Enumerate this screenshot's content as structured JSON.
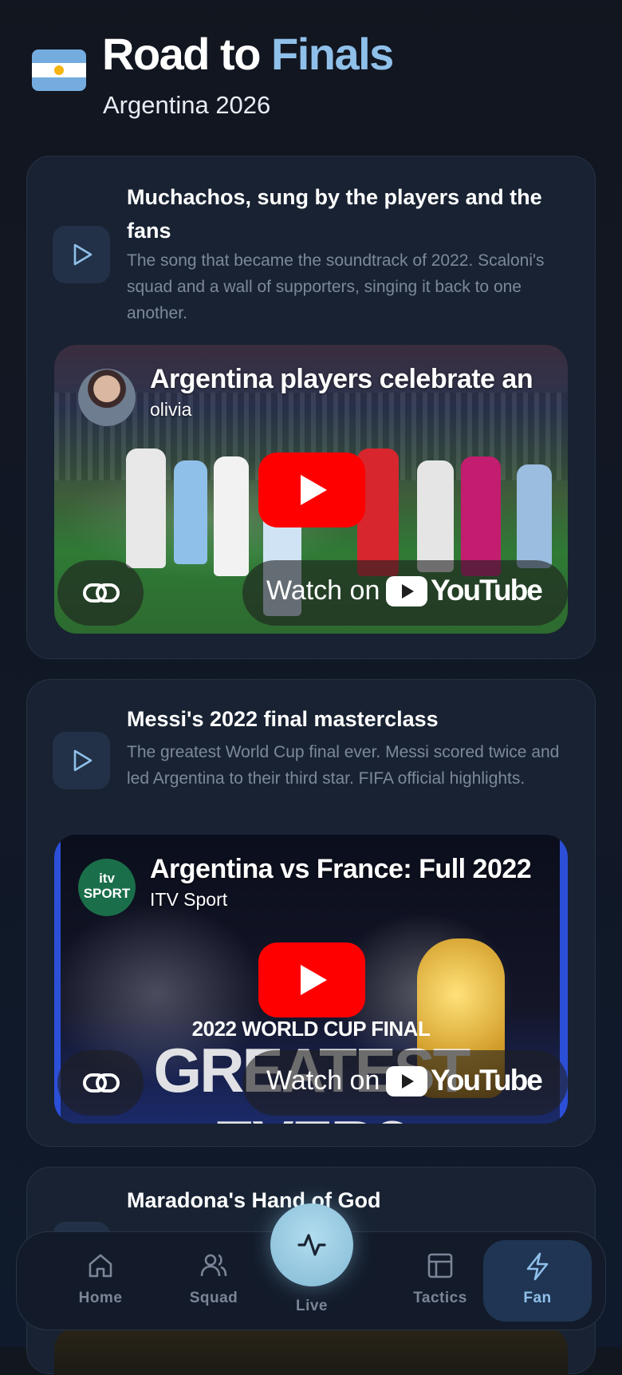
{
  "header": {
    "title_part1": "Road to",
    "title_part2": "Finals",
    "subtitle": "Argentina 2026"
  },
  "cards": [
    {
      "title": "Muchachos, sung by the players and the fans",
      "description": "The song that became the soundtrack of 2022. Scaloni's squad and a wall of supporters, singing it back to one another.",
      "video": {
        "title": "Argentina players celebrate an",
        "channel": "olivia",
        "watch_label": "Watch on",
        "brand": "YouTube"
      }
    },
    {
      "title": "Messi's 2022 final masterclass",
      "description": "The greatest World Cup final ever. Messi scored twice and led Argentina to their third star. FIFA official highlights.",
      "video": {
        "title": "Argentina vs France: Full 2022",
        "channel": "ITV Sport",
        "channel_logo_text_1": "itv",
        "channel_logo_text_2": "SPORT",
        "overlay_small": "2022 WORLD CUP FINAL",
        "overlay_big": "GREATEST EVER?",
        "watch_label": "Watch on",
        "brand": "YouTube"
      }
    },
    {
      "title": "Maradona's Hand of God"
    }
  ],
  "nav": {
    "items": [
      {
        "label": "Home",
        "icon": "home-icon"
      },
      {
        "label": "Squad",
        "icon": "users-icon"
      },
      {
        "label": "Live",
        "icon": "pulse-icon"
      },
      {
        "label": "Tactics",
        "icon": "layout-icon"
      },
      {
        "label": "Fan",
        "icon": "bolt-icon"
      }
    ],
    "active": "Fan"
  },
  "colors": {
    "accent": "#8fc0ea",
    "youtube_red": "#ff0000",
    "card_bg": "#182232"
  }
}
